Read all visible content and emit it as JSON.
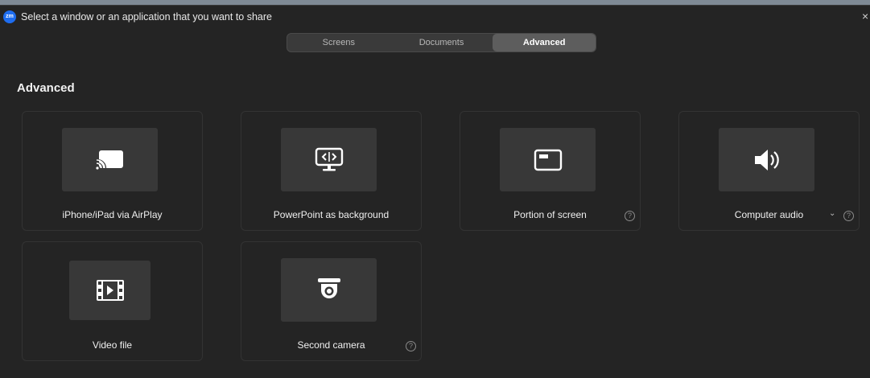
{
  "window": {
    "title": "Select a window or an application that you want to share",
    "logo_text": "zm",
    "close": "×"
  },
  "tabs": [
    {
      "label": "Screens",
      "active": false
    },
    {
      "label": "Documents",
      "active": false
    },
    {
      "label": "Advanced",
      "active": true
    }
  ],
  "section": {
    "title": "Advanced"
  },
  "cards": [
    {
      "label": "iPhone/iPad via AirPlay",
      "icon": "airplay-cast-icon"
    },
    {
      "label": "PowerPoint as background",
      "icon": "powerpoint-monitor-icon"
    },
    {
      "label": "Portion of screen",
      "icon": "screen-portion-icon",
      "help": "?"
    },
    {
      "label": "Computer audio",
      "icon": "speaker-icon",
      "help": "?",
      "dropdown": "⌄"
    },
    {
      "label": "Video file",
      "icon": "film-icon"
    },
    {
      "label": "Second camera",
      "icon": "camera-icon",
      "help": "?"
    }
  ],
  "colors": {
    "background": "#242424",
    "card_border": "#333333",
    "thumb": "#383838",
    "active_tab": "#5d5d5d",
    "accent_logo": "#1e6df0"
  }
}
